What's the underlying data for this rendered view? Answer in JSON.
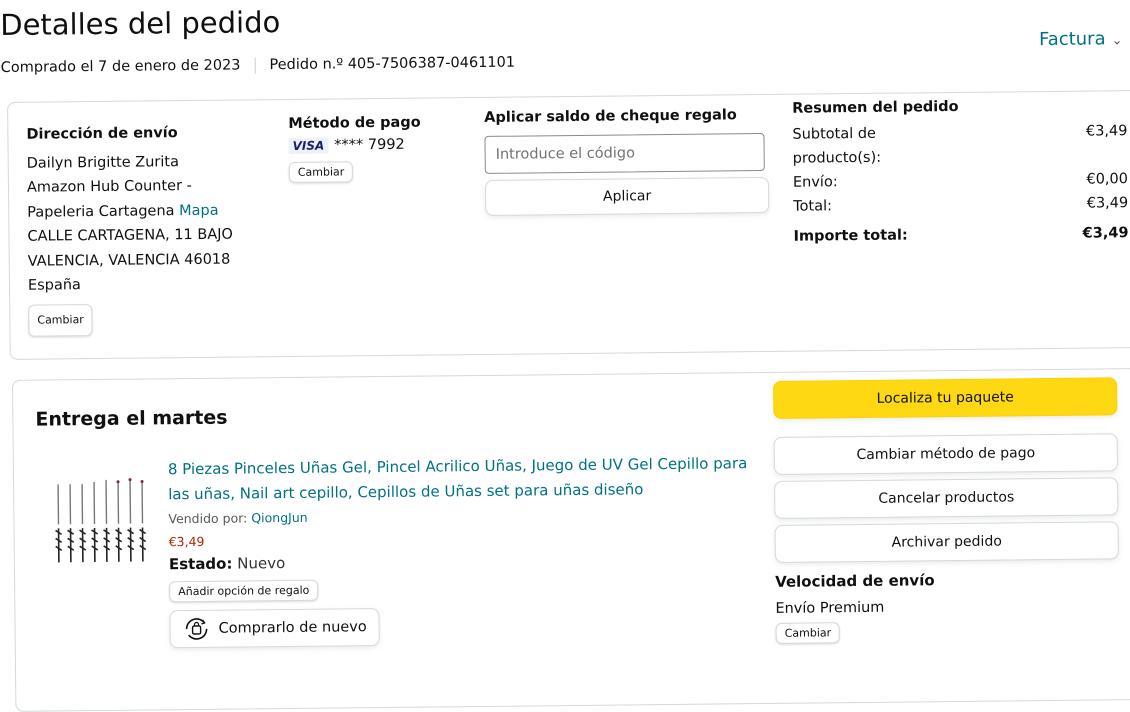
{
  "header": {
    "title": "Detalles del pedido",
    "purchased": "Comprado el 7 de enero de 2023",
    "order": "Pedido n.º 405-7506387-0461101",
    "invoice": "Factura"
  },
  "shipping": {
    "heading": "Dirección de envío",
    "name": "Dailyn Brigitte Zurita",
    "line1": "Amazon Hub Counter -",
    "line2": "Papeleria Cartagena",
    "map_link": "Mapa",
    "line3": "CALLE CARTAGENA, 11 BAJO",
    "line4": "VALENCIA, VALENCIA 46018",
    "country": "España",
    "change": "Cambiar"
  },
  "payment": {
    "heading": "Método de pago",
    "card_brand": "VISA",
    "card": "**** 7992",
    "change": "Cambiar"
  },
  "gift_card": {
    "heading": "Aplicar saldo de cheque regalo",
    "placeholder": "Introduce el código",
    "apply": "Aplicar"
  },
  "summary": {
    "heading": "Resumen del pedido",
    "rows": [
      {
        "label": "Subtotal de producto(s):",
        "value": "€3,49"
      },
      {
        "label": "Envío:",
        "value": "€0,00"
      },
      {
        "label": "Total:",
        "value": "€3,49"
      }
    ],
    "grand_label": "Importe total:",
    "grand_value": "€3,49"
  },
  "delivery": {
    "heading": "Entrega el martes",
    "product": {
      "title": "8 Piezas Pinceles Uñas Gel, Pincel Acrilico Uñas, Juego de UV Gel Cepillo para las uñas, Nail art cepillo, Cepillos de Uñas set para uñas diseño",
      "sold_label": "Vendido por:",
      "seller": "QiongJun",
      "price": "€3,49",
      "state_label": "Estado:",
      "state": "Nuevo",
      "gift_option": "Añadir opción de regalo",
      "buy_again": "Comprarlo de nuevo"
    },
    "actions": [
      "Localiza tu paquete",
      "Cambiar método de pago",
      "Cancelar productos",
      "Archivar pedido"
    ],
    "speed_heading": "Velocidad de envío",
    "speed": "Envío Premium",
    "speed_change": "Cambiar"
  },
  "colors": {
    "accent": "#007185",
    "price": "#B12704",
    "primary_button": "#FFD814"
  }
}
